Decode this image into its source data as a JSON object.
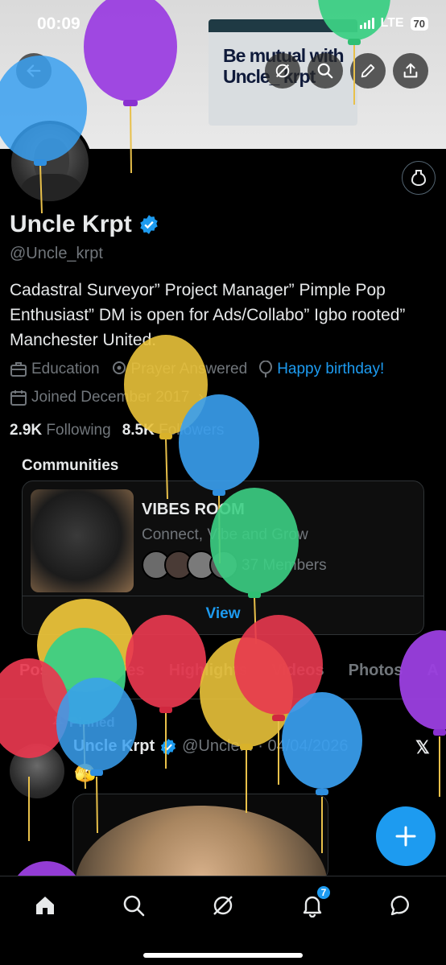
{
  "status_bar": {
    "time": "00:09",
    "network": "LTE",
    "battery": "70"
  },
  "banner": {
    "text": "Be mutual with Uncle_ krpt"
  },
  "profile": {
    "display_name": "Uncle Krpt",
    "handle": "@Uncle_krpt",
    "bio": "Cadastral Surveyor” Project Manager” Pimple Pop Enthusiast” DM is open for Ads/Collabo” Igbo rooted” Manchester United.",
    "category": "Education",
    "location": "Prayer Answered",
    "birthday": "Happy birthday!",
    "joined": "Joined December 2017",
    "following_count": "2.9K",
    "following_label": "Following",
    "followers_count": "8.5K",
    "followers_label": "Followers"
  },
  "communities": {
    "title": "Communities",
    "card": {
      "name": "VIBES ROOM",
      "tagline": "Connect, Vibe and Grow",
      "members": "37 Members",
      "action": "View"
    }
  },
  "tabs": [
    "Posts",
    "Replies",
    "Highlights",
    "Videos",
    "Photos",
    "A"
  ],
  "tweet": {
    "pinned_label": "Pinned",
    "name": "Uncle Krpt",
    "handle_short": "@Uncle...",
    "date": "· 04/04/2026",
    "x_mark": "𝕏",
    "emoji": "🫣"
  },
  "nav": {
    "notification_count": "7"
  },
  "colors": {
    "accent": "#1d9bf0",
    "background": "#000000",
    "secondary_text": "#71767b"
  }
}
